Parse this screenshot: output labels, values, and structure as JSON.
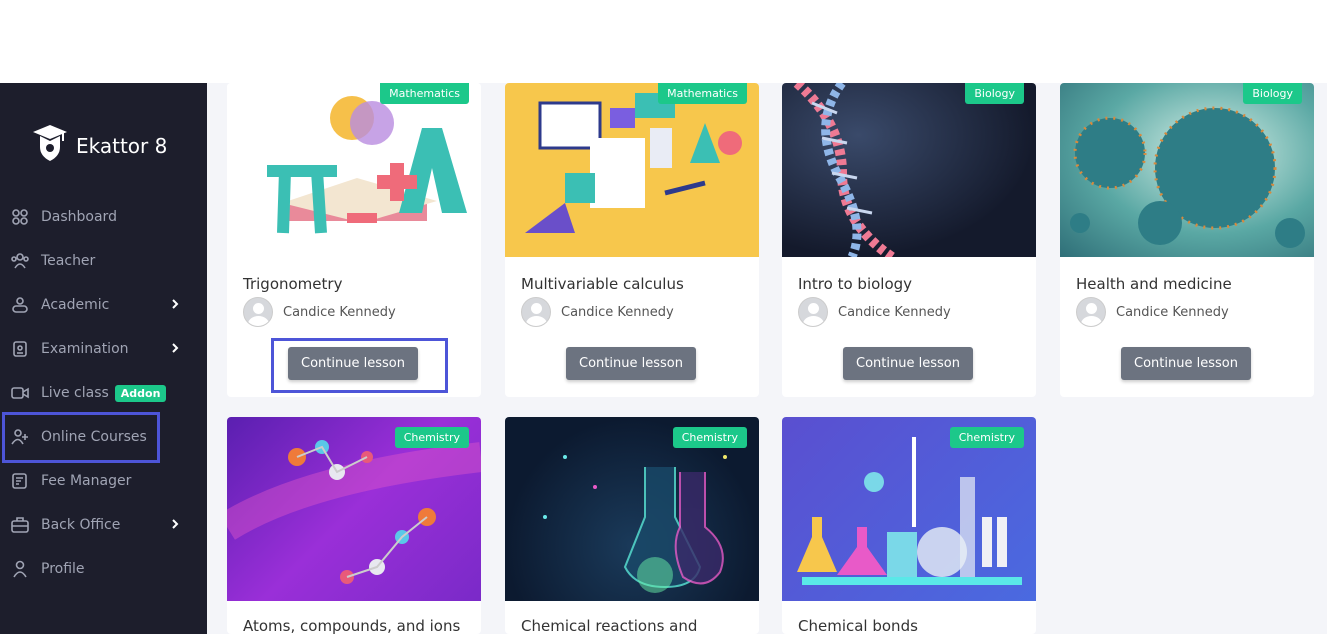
{
  "app": {
    "brand": "Ekattor 8"
  },
  "sidebar": {
    "items": [
      {
        "label": "Dashboard",
        "icon": "dashboard-icon"
      },
      {
        "label": "Teacher",
        "icon": "teacher-icon"
      },
      {
        "label": "Academic",
        "icon": "academic-icon",
        "has_submenu": true
      },
      {
        "label": "Examination",
        "icon": "examination-icon",
        "has_submenu": true
      },
      {
        "label": "Live class",
        "icon": "video-icon",
        "badge": "Addon"
      },
      {
        "label": "Online Courses",
        "icon": "user-plus-icon"
      },
      {
        "label": "Fee Manager",
        "icon": "fee-icon"
      },
      {
        "label": "Back Office",
        "icon": "briefcase-icon",
        "has_submenu": true
      },
      {
        "label": "Profile",
        "icon": "profile-icon"
      }
    ]
  },
  "courses": [
    {
      "title": "Trigonometry",
      "category": "Mathematics",
      "author": "Candice Kennedy",
      "button": "Continue lesson"
    },
    {
      "title": "Multivariable calculus",
      "category": "Mathematics",
      "author": "Candice Kennedy",
      "button": "Continue lesson"
    },
    {
      "title": "Intro to biology",
      "category": "Biology",
      "author": "Candice Kennedy",
      "button": "Continue lesson"
    },
    {
      "title": "Health and medicine",
      "category": "Biology",
      "author": "Candice Kennedy",
      "button": "Continue lesson"
    },
    {
      "title": "Atoms, compounds, and ions",
      "category": "Chemistry"
    },
    {
      "title": "Chemical reactions and",
      "category": "Chemistry"
    },
    {
      "title": "Chemical bonds",
      "category": "Chemistry"
    }
  ],
  "colors": {
    "accent": "#1cc88a",
    "sidebar_bg": "#1d1e2c",
    "highlight": "#4d55d8",
    "button": "#6c7380"
  }
}
